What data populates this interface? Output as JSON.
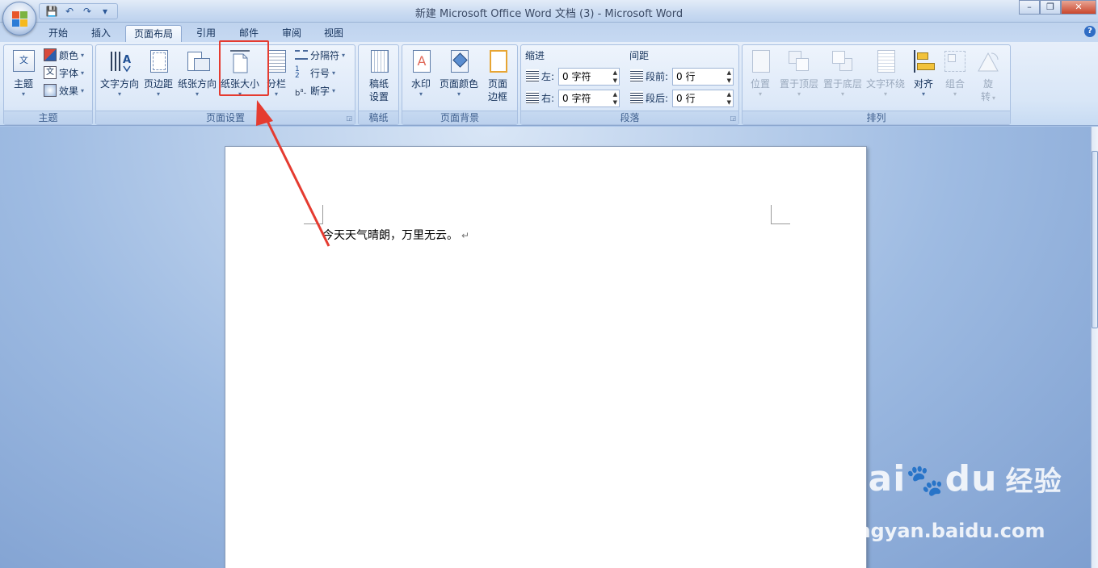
{
  "window": {
    "title": "新建 Microsoft Office Word 文档 (3) - Microsoft Word",
    "controls": {
      "minimize": "–",
      "maximize": "❐",
      "close": "✕"
    }
  },
  "qat": {
    "save": "💾",
    "undo": "↶",
    "redo": "↷",
    "customize": "▾"
  },
  "tabs": [
    "开始",
    "插入",
    "页面布局",
    "引用",
    "邮件",
    "审阅",
    "视图"
  ],
  "active_tab": "页面布局",
  "help": "?",
  "ribbon": {
    "theme": {
      "label": "主题",
      "btn": "主题",
      "colors": "颜色",
      "fonts": "字体",
      "effects": "效果"
    },
    "page_setup": {
      "label": "页面设置",
      "text_direction": "文字方向",
      "margins": "页边距",
      "orientation": "纸张方向",
      "size": "纸张大小",
      "columns": "分栏",
      "breaks": "分隔符",
      "line_numbers": "行号",
      "hyphenation": "断字"
    },
    "draft": {
      "label": "稿纸",
      "settings_line1": "稿纸",
      "settings_line2": "设置"
    },
    "background": {
      "label": "页面背景",
      "watermark": "水印",
      "page_color": "页面颜色",
      "borders_line1": "页面",
      "borders_line2": "边框"
    },
    "paragraph": {
      "label": "段落",
      "indent": "缩进",
      "spacing": "间距",
      "left": "左:",
      "right": "右:",
      "before": "段前:",
      "after": "段后:",
      "left_value": "0 字符",
      "right_value": "0 字符",
      "before_value": "0 行",
      "after_value": "0 行"
    },
    "arrange": {
      "label": "排列",
      "position": "位置",
      "bring_front": "置于顶层",
      "send_back": "置于底层",
      "text_wrap": "文字环绕",
      "align": "对齐",
      "group": "组合",
      "rotate_line1": "旋",
      "rotate_line2": "转"
    }
  },
  "document": {
    "text": "今天天气晴朗，万里无云。",
    "para_mark": "↵"
  },
  "watermark": {
    "brand": "Bai",
    "brand2": "du",
    "cn": "经验",
    "url": "jingyan.baidu.com"
  },
  "colors": {
    "highlight": "#e53b30",
    "accent": "#2b5797"
  }
}
